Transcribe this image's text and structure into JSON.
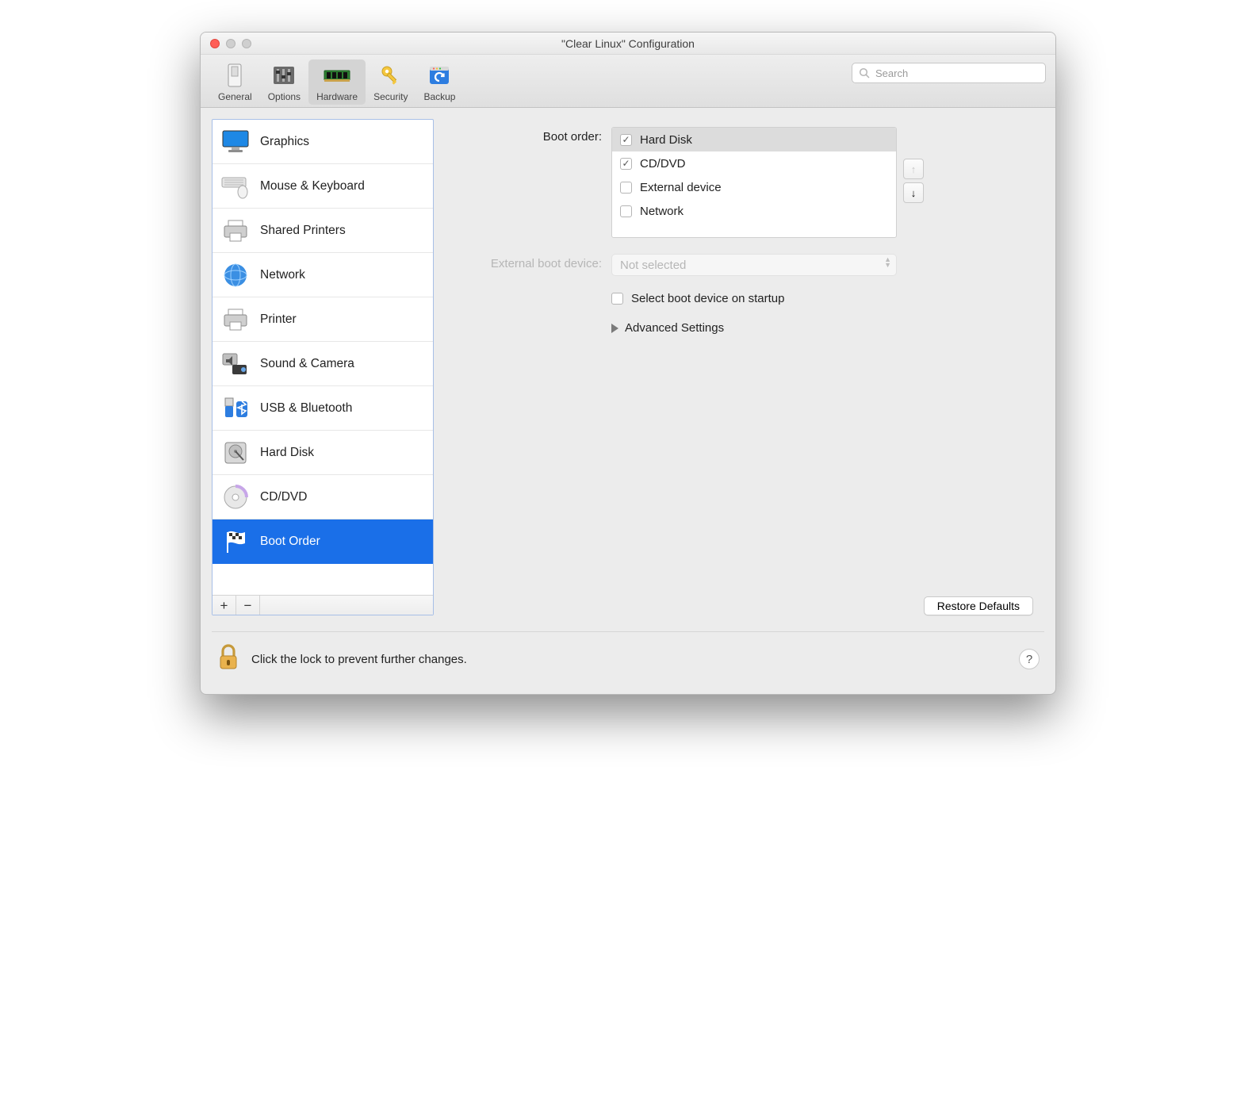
{
  "window": {
    "title": "\"Clear Linux\" Configuration"
  },
  "toolbar": {
    "tabs": [
      {
        "label": "General",
        "selected": false
      },
      {
        "label": "Options",
        "selected": false
      },
      {
        "label": "Hardware",
        "selected": true
      },
      {
        "label": "Security",
        "selected": false
      },
      {
        "label": "Backup",
        "selected": false
      }
    ],
    "search_placeholder": "Search"
  },
  "sidebar": {
    "items": [
      {
        "label": "Graphics"
      },
      {
        "label": "Mouse & Keyboard"
      },
      {
        "label": "Shared Printers"
      },
      {
        "label": "Network"
      },
      {
        "label": "Printer"
      },
      {
        "label": "Sound & Camera"
      },
      {
        "label": "USB & Bluetooth"
      },
      {
        "label": "Hard Disk"
      },
      {
        "label": "CD/DVD"
      },
      {
        "label": "Boot Order"
      }
    ],
    "selected_index": 9,
    "add_label": "+",
    "remove_label": "−"
  },
  "boot": {
    "order_label": "Boot order:",
    "items": [
      {
        "label": "Hard Disk",
        "checked": true,
        "selected": true
      },
      {
        "label": "CD/DVD",
        "checked": true,
        "selected": false
      },
      {
        "label": "External device",
        "checked": false,
        "selected": false
      },
      {
        "label": "Network",
        "checked": false,
        "selected": false
      }
    ],
    "external_label": "External boot device:",
    "external_value": "Not selected",
    "startup_checkbox_label": "Select boot device on startup",
    "startup_checked": false,
    "advanced_label": "Advanced Settings",
    "restore_defaults_label": "Restore Defaults"
  },
  "lockbar": {
    "text": "Click the lock to prevent further changes.",
    "help_label": "?"
  }
}
